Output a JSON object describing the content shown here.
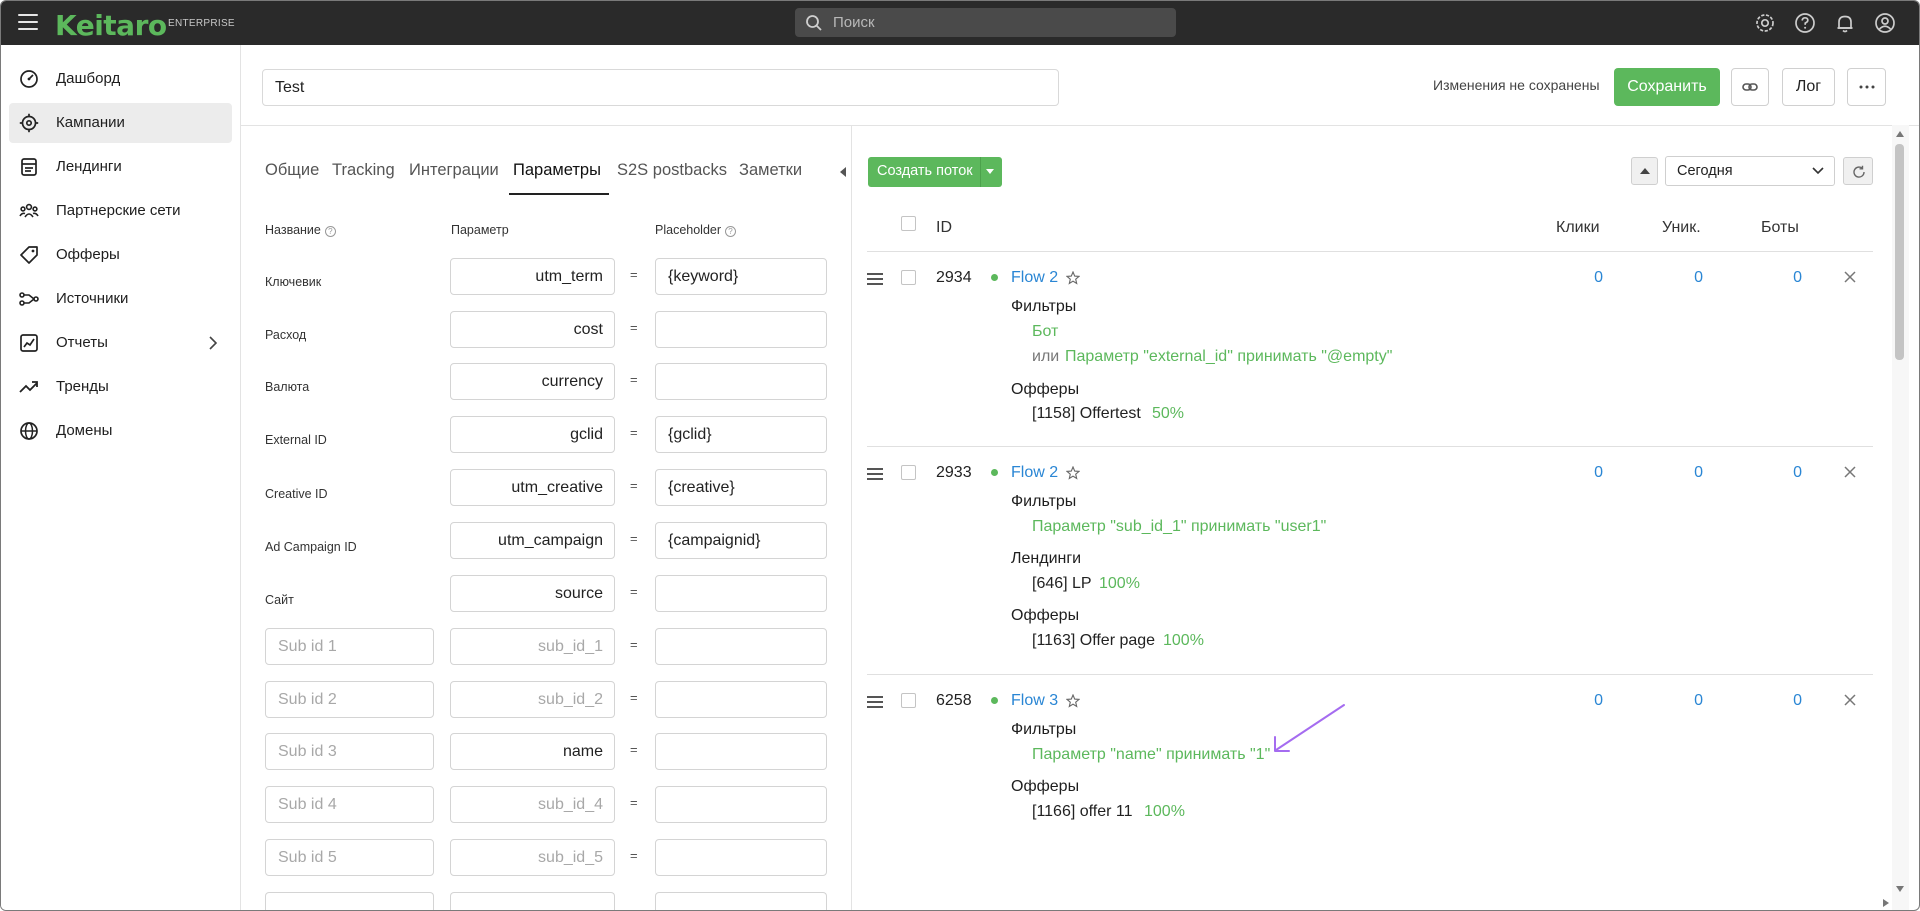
{
  "app": {
    "logo": "Keitaro",
    "edition": "ENTERPRISE"
  },
  "search": {
    "placeholder": "Поиск"
  },
  "sidebar": {
    "items": [
      {
        "label": "Дашборд",
        "icon": "dashboard-icon"
      },
      {
        "label": "Кампании",
        "icon": "campaigns-icon",
        "active": true
      },
      {
        "label": "Лендинги",
        "icon": "landings-icon"
      },
      {
        "label": "Партнерские сети",
        "icon": "affiliate-networks-icon"
      },
      {
        "label": "Офферы",
        "icon": "offers-icon"
      },
      {
        "label": "Источники",
        "icon": "sources-icon"
      },
      {
        "label": "Отчеты",
        "icon": "reports-icon"
      },
      {
        "label": "Тренды",
        "icon": "trends-icon"
      },
      {
        "label": "Домены",
        "icon": "domains-icon"
      }
    ]
  },
  "header": {
    "campaign_name": "Test",
    "unsaved_text": "Изменения не сохранены",
    "save_label": "Сохранить",
    "log_label": "Лог"
  },
  "tabs": [
    "Общие",
    "Tracking",
    "Интеграции",
    "Параметры",
    "S2S postbacks",
    "Заметки"
  ],
  "active_tab": "Параметры",
  "params": {
    "head_name": "Название",
    "head_param": "Параметр",
    "head_placeholder": "Placeholder",
    "rows": [
      {
        "name": "Ключевик",
        "param": "utm_term",
        "placeholder": "{keyword}"
      },
      {
        "name": "Расход",
        "param": "cost",
        "placeholder": ""
      },
      {
        "name": "Валюта",
        "param": "currency",
        "placeholder": ""
      },
      {
        "name": "External ID",
        "param": "gclid",
        "placeholder": "{gclid}"
      },
      {
        "name": "Creative ID",
        "param": "utm_creative",
        "placeholder": "{creative}"
      },
      {
        "name": "Ad Campaign ID",
        "param": "utm_campaign",
        "placeholder": "{campaignid}"
      },
      {
        "name": "Сайт",
        "param": "source",
        "placeholder": ""
      }
    ],
    "sub_rows": [
      {
        "name_placeholder": "Sub id 1",
        "param": "",
        "param_placeholder": "sub_id_1"
      },
      {
        "name_placeholder": "Sub id 2",
        "param": "",
        "param_placeholder": "sub_id_2"
      },
      {
        "name_placeholder": "Sub id 3",
        "param": "name",
        "param_placeholder": "sub_id_3"
      },
      {
        "name_placeholder": "Sub id 4",
        "param": "",
        "param_placeholder": "sub_id_4"
      },
      {
        "name_placeholder": "Sub id 5",
        "param": "",
        "param_placeholder": "sub_id_5"
      }
    ],
    "eq": "="
  },
  "flows_toolbar": {
    "create_label": "Создать поток",
    "date_range": "Сегодня"
  },
  "flows_table": {
    "headers": {
      "id": "ID",
      "clicks": "Клики",
      "unique": "Уник.",
      "bots": "Боты"
    },
    "flows": [
      {
        "id": "2934",
        "name": "Flow 2",
        "clicks": "0",
        "unique": "0",
        "bots": "0",
        "filters_title": "Фильтры",
        "filter_1": "Бот",
        "or_label": "или",
        "filter_2": "Параметр \"external_id\"  принимать \"@empty\"",
        "offers_title": "Офферы",
        "offer": "[1158] Offertest",
        "offer_share": "50%"
      },
      {
        "id": "2933",
        "name": "Flow 2",
        "clicks": "0",
        "unique": "0",
        "bots": "0",
        "filters_title": "Фильтры",
        "filter_1": "Параметр \"sub_id_1\"  принимать \"user1\"",
        "landings_title": "Лендинги",
        "landing": "[646] LP",
        "landing_share": "100%",
        "offers_title": "Офферы",
        "offer": "[1163] Offer page",
        "offer_share": "100%"
      },
      {
        "id": "6258",
        "name": "Flow 3",
        "clicks": "0",
        "unique": "0",
        "bots": "0",
        "filters_title": "Фильтры",
        "filter_1": "Параметр \"name\"  принимать \"1\"",
        "offers_title": "Офферы",
        "offer": "[1166] offer 11",
        "offer_share": "100%"
      }
    ]
  },
  "colors": {
    "brand": "#5cb85c",
    "link": "#2a86d4",
    "topbar": "#2a2a2a",
    "annotation_arrow": "#a56cf0"
  }
}
